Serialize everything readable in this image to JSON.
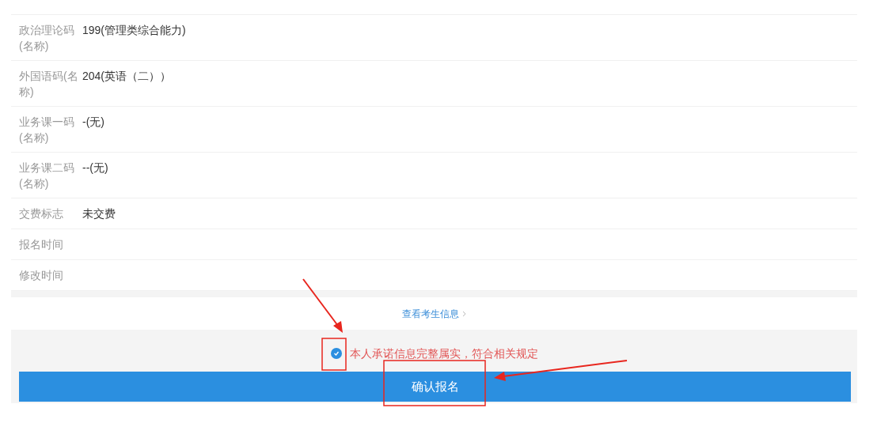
{
  "rows": [
    {
      "label": "政治理论码(名称)",
      "value": "199(管理类综合能力)"
    },
    {
      "label": "外国语码(名称)",
      "value": "204(英语（二））"
    },
    {
      "label": "业务课一码(名称)",
      "value": "-(无)"
    },
    {
      "label": "业务课二码(名称)",
      "value": "--(无)"
    },
    {
      "label": "交费标志",
      "value": "未交费"
    },
    {
      "label": "报名时间"
    },
    {
      "label": "修改时间"
    }
  ],
  "link": {
    "label": "查看考生信息"
  },
  "pledge": {
    "text": "本人承诺信息完整属实，符合相关规定",
    "checked": true
  },
  "submit": {
    "label": "确认报名"
  }
}
